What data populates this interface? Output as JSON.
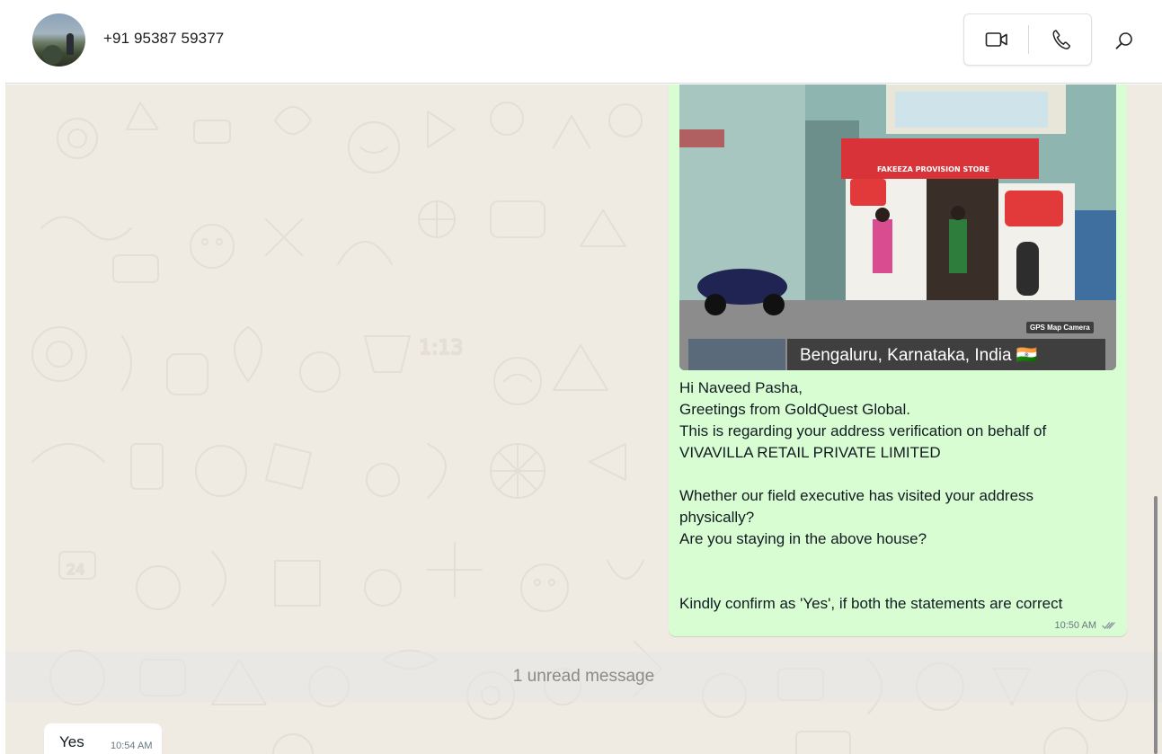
{
  "header": {
    "contact_name": "+91 95387 59377",
    "video_call_icon": "video-camera-icon",
    "voice_call_icon": "phone-icon",
    "search_icon": "search-icon"
  },
  "messages": {
    "outgoing": {
      "photo_caption": "Bengaluru, Karnataka, India 🇮🇳",
      "photo_badge": "GPS Map Camera",
      "shop_sign": "FAKEEZA PROVISION STORE",
      "text": "Hi Naveed Pasha,\nGreetings from GoldQuest Global.\nThis is regarding your address verification on behalf of VIVAVILLA RETAIL PRIVATE LIMITED\n\nWhether our field executive has visited your address physically?\nAre you staying in the above house?\n\n\nKindly confirm as 'Yes', if both the statements are correct",
      "time": "10:50 AM",
      "status_icon": "double-check-icon"
    },
    "unread_divider": "1 unread message",
    "incoming": {
      "text": "Yes",
      "time": "10:54 AM"
    }
  },
  "colors": {
    "outgoing_bubble": "#d9fdd3",
    "incoming_bubble": "#ffffff",
    "chat_background": "#efeae2"
  }
}
